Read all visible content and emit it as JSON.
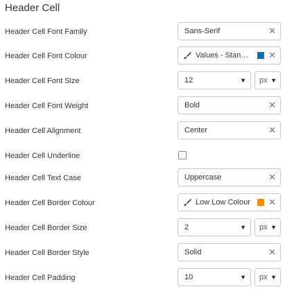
{
  "section_title": "Header Cell",
  "rows": [
    {
      "label": "Header Cell Font Family",
      "value": "Sans-Serif"
    },
    {
      "label": "Header Cell Font Colour",
      "value": "Values - Standard",
      "color": "#1a6bb0"
    },
    {
      "label": "Header Cell Font Size",
      "value": "12",
      "unit": "px"
    },
    {
      "label": "Header Cell Font Weight",
      "value": "Bold"
    },
    {
      "label": "Header Cell Alignment",
      "value": "Center"
    },
    {
      "label": "Header Cell Underline",
      "checked": false
    },
    {
      "label": "Header Cell Text Case",
      "value": "Uppercase"
    },
    {
      "label": "Header Cell Border Colour",
      "value": "Low Low Colour",
      "color": "#ff8c00"
    },
    {
      "label": "Header Cell Border Size",
      "value": "2",
      "unit": "px"
    },
    {
      "label": "Header Cell Border Style",
      "value": "Solid"
    },
    {
      "label": "Header Cell Padding",
      "value": "10",
      "unit": "px"
    }
  ],
  "icons": {
    "clear": "close-icon",
    "brush": "paintbrush-icon",
    "caret": "caret-down-icon"
  }
}
